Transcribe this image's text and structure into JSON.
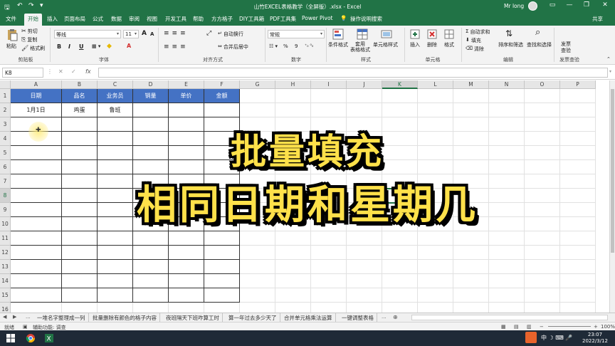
{
  "window": {
    "title": "山竹EXCEL表格教学（全屏版）.xlsx  -  Excel",
    "user": "Mr long",
    "controls": {
      "minimize": "—",
      "restore": "❐",
      "close": "✕",
      "ribbon_display": "▭"
    }
  },
  "quick_access": {
    "save": "🖫",
    "undo": "↶",
    "redo": "↷",
    "customize": "▾"
  },
  "tabs": [
    "文件",
    "开始",
    "插入",
    "页面布局",
    "公式",
    "数据",
    "审阅",
    "视图",
    "开发工具",
    "帮助",
    "方方格子",
    "DIY工具箱",
    "PDF工具集",
    "Power Pivot",
    "操作说明搜索"
  ],
  "active_tab": "开始",
  "share": "共享",
  "ribbon": {
    "clipboard": {
      "paste": "粘贴",
      "cut": "剪切",
      "copy": "复制",
      "format_painter": "格式刷",
      "label": "剪贴板"
    },
    "font": {
      "name": "等线",
      "size": "11",
      "bold": "B",
      "italic": "I",
      "underline": "U",
      "font_color_letter": "A",
      "grow": "A",
      "shrink": "A",
      "label": "字体"
    },
    "alignment": {
      "wrap": "自动换行",
      "merge": "合并后居中",
      "label": "对齐方式"
    },
    "number": {
      "format": "常规",
      "percent": "%",
      "comma": "9",
      "label": "数字"
    },
    "styles": {
      "conditional": "条件格式",
      "table": "套用\n表格格式",
      "cell_styles": "单元格样式",
      "label": "样式"
    },
    "cells": {
      "insert": "插入",
      "delete": "删除",
      "format": "格式",
      "label": "单元格"
    },
    "editing": {
      "autosum": "自动求和",
      "fill": "填充",
      "clear": "清除",
      "sort_filter": "排序和筛选",
      "find_select": "查找和选择",
      "label": "编辑"
    },
    "invoice": {
      "check": "发票\n查验",
      "label": "发票查验"
    }
  },
  "formula_bar": {
    "name_box": "K8",
    "cancel": "✕",
    "enter": "✓",
    "fx": "fx",
    "value": ""
  },
  "sheet": {
    "columns": [
      "A",
      "B",
      "C",
      "D",
      "E",
      "F",
      "G",
      "H",
      "I",
      "J",
      "K",
      "L",
      "M",
      "N",
      "O",
      "P"
    ],
    "selected_column": "K",
    "rows": [
      "1",
      "2",
      "3",
      "4",
      "5",
      "6",
      "7",
      "8",
      "9",
      "10",
      "11",
      "12",
      "13",
      "14",
      "15",
      "16"
    ],
    "selected_row": "8",
    "table_headers": [
      "日期",
      "品名",
      "业务员",
      "销量",
      "单价",
      "金额"
    ],
    "table_rows": [
      [
        "1月1日",
        "鸡蛋",
        "鲁班",
        "",
        "",
        ""
      ]
    ]
  },
  "overlay": {
    "line1": "批量填充",
    "line2": "相同日期和星期几"
  },
  "sheet_tabs": [
    "一堆名字整理成一列",
    "批量删除有颜色的格子内容",
    "夜班隔天下班咋算工时",
    "算一年过去多少天了",
    "合并单元格乘法运算",
    "一键调整表格"
  ],
  "sheet_nav": {
    "prev": "◀",
    "next": "▶",
    "more": "...",
    "add": "⊕"
  },
  "status": {
    "mode": "就绪",
    "accessibility": "辅助功能: 调查",
    "zoom": "100%"
  },
  "taskbar": {
    "time": "23:07",
    "date": "2022/3/12"
  },
  "colors": {
    "brand": "#217346",
    "table_header": "#4472c4",
    "overlay_text": "#ffe14a"
  }
}
